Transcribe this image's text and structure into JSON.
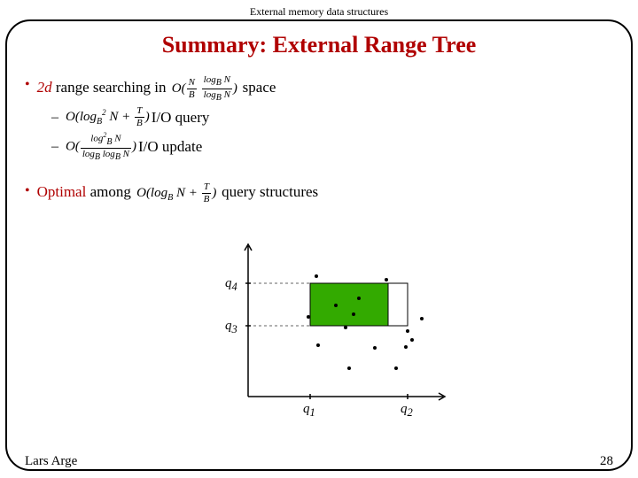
{
  "header": {
    "course": "External memory data structures"
  },
  "title": "Summary: External Range Tree",
  "bullet1": {
    "term": "2d",
    "text_after_term": " range searching in ",
    "formula_prefix": "O(",
    "formula_close": ")",
    "tail": "space"
  },
  "sub1": {
    "formula_prefix": "O(log",
    "sub_b": "B",
    "mid": " N + ",
    "frac_num": "T",
    "frac_den": "B",
    "close": ")",
    "tail": "I/O query"
  },
  "sub2": {
    "formula_prefix": "O(",
    "close": ")",
    "tail": "I/O update"
  },
  "bullet2": {
    "term": "Optimal",
    "mid": " among ",
    "tail": " query structures"
  },
  "axis": {
    "q1": "q",
    "q1_sub": "1",
    "q2": "q",
    "q2_sub": "2",
    "q3": "q",
    "q3_sub": "3",
    "q4": "q",
    "q4_sub": "4"
  },
  "footer": {
    "author": "Lars Arge",
    "page": "28"
  },
  "chart_data": {
    "type": "scatter",
    "title": "",
    "xlabel": "",
    "ylabel": "",
    "xlim": [
      0,
      10
    ],
    "ylim": [
      0,
      10
    ],
    "query_rect": {
      "x1": 3.2,
      "y1": 5.0,
      "x2": 8.2,
      "y2": 8.0
    },
    "highlight_rect": {
      "x1": 3.2,
      "y1": 5.0,
      "x2": 7.2,
      "y2": 8.0
    },
    "axis_marks": {
      "q1": 3.2,
      "q2": 8.2,
      "q3": 5.0,
      "q4": 8.0
    },
    "points": [
      {
        "x": 3.5,
        "y": 8.5
      },
      {
        "x": 7.1,
        "y": 8.2
      },
      {
        "x": 4.5,
        "y": 6.4
      },
      {
        "x": 5.7,
        "y": 6.9
      },
      {
        "x": 5.4,
        "y": 5.8
      },
      {
        "x": 3.1,
        "y": 5.6
      },
      {
        "x": 8.9,
        "y": 5.5
      },
      {
        "x": 5.0,
        "y": 4.9
      },
      {
        "x": 3.6,
        "y": 3.6
      },
      {
        "x": 6.5,
        "y": 3.4
      },
      {
        "x": 8.2,
        "y": 4.6
      },
      {
        "x": 8.4,
        "y": 4.0
      },
      {
        "x": 8.1,
        "y": 3.5
      },
      {
        "x": 5.2,
        "y": 2.0
      },
      {
        "x": 7.6,
        "y": 2.0
      }
    ]
  }
}
